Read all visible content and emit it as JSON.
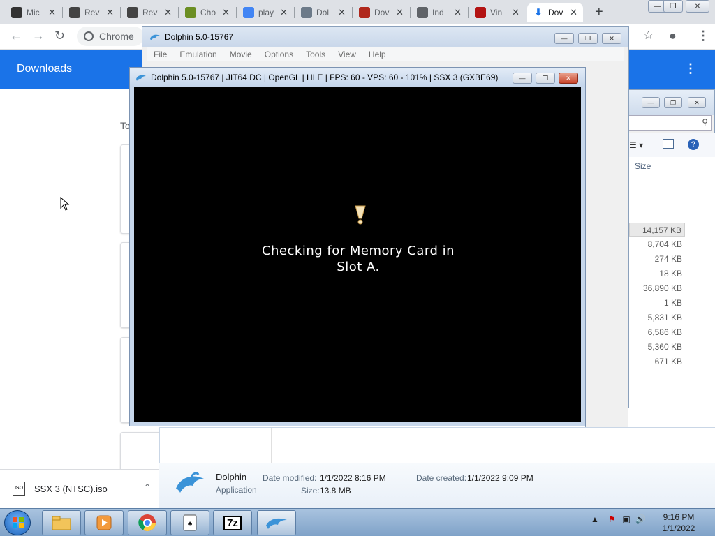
{
  "browser": {
    "tabs": [
      {
        "label": "Mic",
        "icon": "microsoft-store-icon",
        "color": "#333333"
      },
      {
        "label": "Rev",
        "icon": "review-site-icon",
        "color": "#444444"
      },
      {
        "label": "Rev",
        "icon": "review-site-icon",
        "color": "#444444"
      },
      {
        "label": "Cho",
        "icon": "game-site-icon",
        "color": "#6b8e23"
      },
      {
        "label": "play",
        "icon": "google-icon",
        "color": "#4285f4"
      },
      {
        "label": "Dol",
        "icon": "dolphin-icon",
        "color": "#6c7a89"
      },
      {
        "label": "Dov",
        "icon": "download-site-icon",
        "color": "#b0281d"
      },
      {
        "label": "Ind",
        "icon": "globe-icon",
        "color": "#5f6368"
      },
      {
        "label": "Vin",
        "icon": "vimm-icon",
        "color": "#b31313"
      },
      {
        "label": "Dov",
        "icon": "download-icon",
        "color": "#1a73e8",
        "active": true
      }
    ],
    "omnibox_text": "Chrome",
    "downloads": {
      "title": "Downloads",
      "section": "To",
      "shelf_item": "SSX 3 (NTSC).iso"
    }
  },
  "dolphin_main": {
    "title": "Dolphin 5.0-15767",
    "menu": [
      "File",
      "Emulation",
      "Movie",
      "Options",
      "Tools",
      "View",
      "Help"
    ]
  },
  "render_window": {
    "title": "Dolphin 5.0-15767 | JIT64 DC | OpenGL | HLE | FPS: 60 - VPS: 60 - 101% | SSX 3 (GXBE69)",
    "message_line1": "Checking for Memory Card in",
    "message_line2": "Slot A."
  },
  "explorer": {
    "size_header": "Size",
    "sizes": [
      "14,157 KB",
      "8,704 KB",
      "274 KB",
      "18 KB",
      "36,890 KB",
      "1 KB",
      "5,831 KB",
      "6,586 KB",
      "5,360 KB",
      "671 KB"
    ],
    "details": {
      "name": "Dolphin",
      "type": "Application",
      "modified_label": "Date modified:",
      "modified_value": "1/1/2022 8:16 PM",
      "size_label": "Size:",
      "size_value": "13.8 MB",
      "created_label": "Date created:",
      "created_value": "1/1/2022 9:09 PM"
    }
  },
  "taskbar": {
    "apps": [
      "file-explorer",
      "media-player",
      "chrome",
      "solitaire",
      "7-zip",
      "dolphin"
    ],
    "seven_zip_label": "7z",
    "time": "9:16 PM",
    "date": "1/1/2022"
  }
}
